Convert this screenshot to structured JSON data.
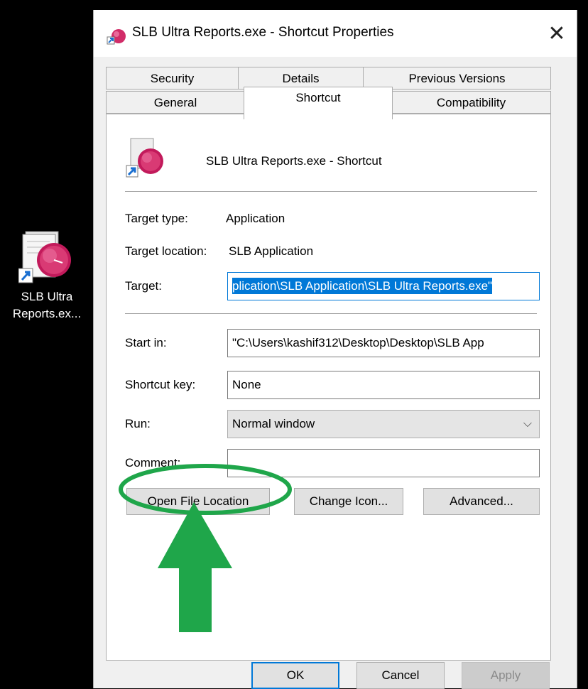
{
  "desktop": {
    "icon_label_line1": "SLB Ultra",
    "icon_label_line2": "Reports.ex..."
  },
  "window": {
    "title": "SLB Ultra Reports.exe - Shortcut Properties",
    "close_glyph": "✕"
  },
  "tabs": {
    "row1": [
      "Security",
      "Details",
      "Previous Versions"
    ],
    "row2": [
      "General",
      "Shortcut",
      "Compatibility"
    ],
    "active": "Shortcut"
  },
  "shortcut": {
    "name": "SLB Ultra Reports.exe - Shortcut",
    "target_type_label": "Target type:",
    "target_type_value": "Application",
    "target_location_label": "Target location:",
    "target_location_value": "SLB Application",
    "target_label": "Target:",
    "target_value": "plication\\SLB Application\\SLB Ultra Reports.exe\"",
    "start_in_label": "Start in:",
    "start_in_value": "\"C:\\Users\\kashif312\\Desktop\\Desktop\\SLB App",
    "shortcut_key_label": "Shortcut key:",
    "shortcut_key_value": "None",
    "run_label": "Run:",
    "run_value": "Normal window",
    "comment_label": "Comment:",
    "comment_value": ""
  },
  "buttons": {
    "open_file_location": "Open File Location",
    "change_icon": "Change Icon...",
    "advanced": "Advanced...",
    "ok": "OK",
    "cancel": "Cancel",
    "apply": "Apply"
  },
  "colors": {
    "annotation_green": "#1fa64a",
    "selection_blue": "#0078d7"
  }
}
